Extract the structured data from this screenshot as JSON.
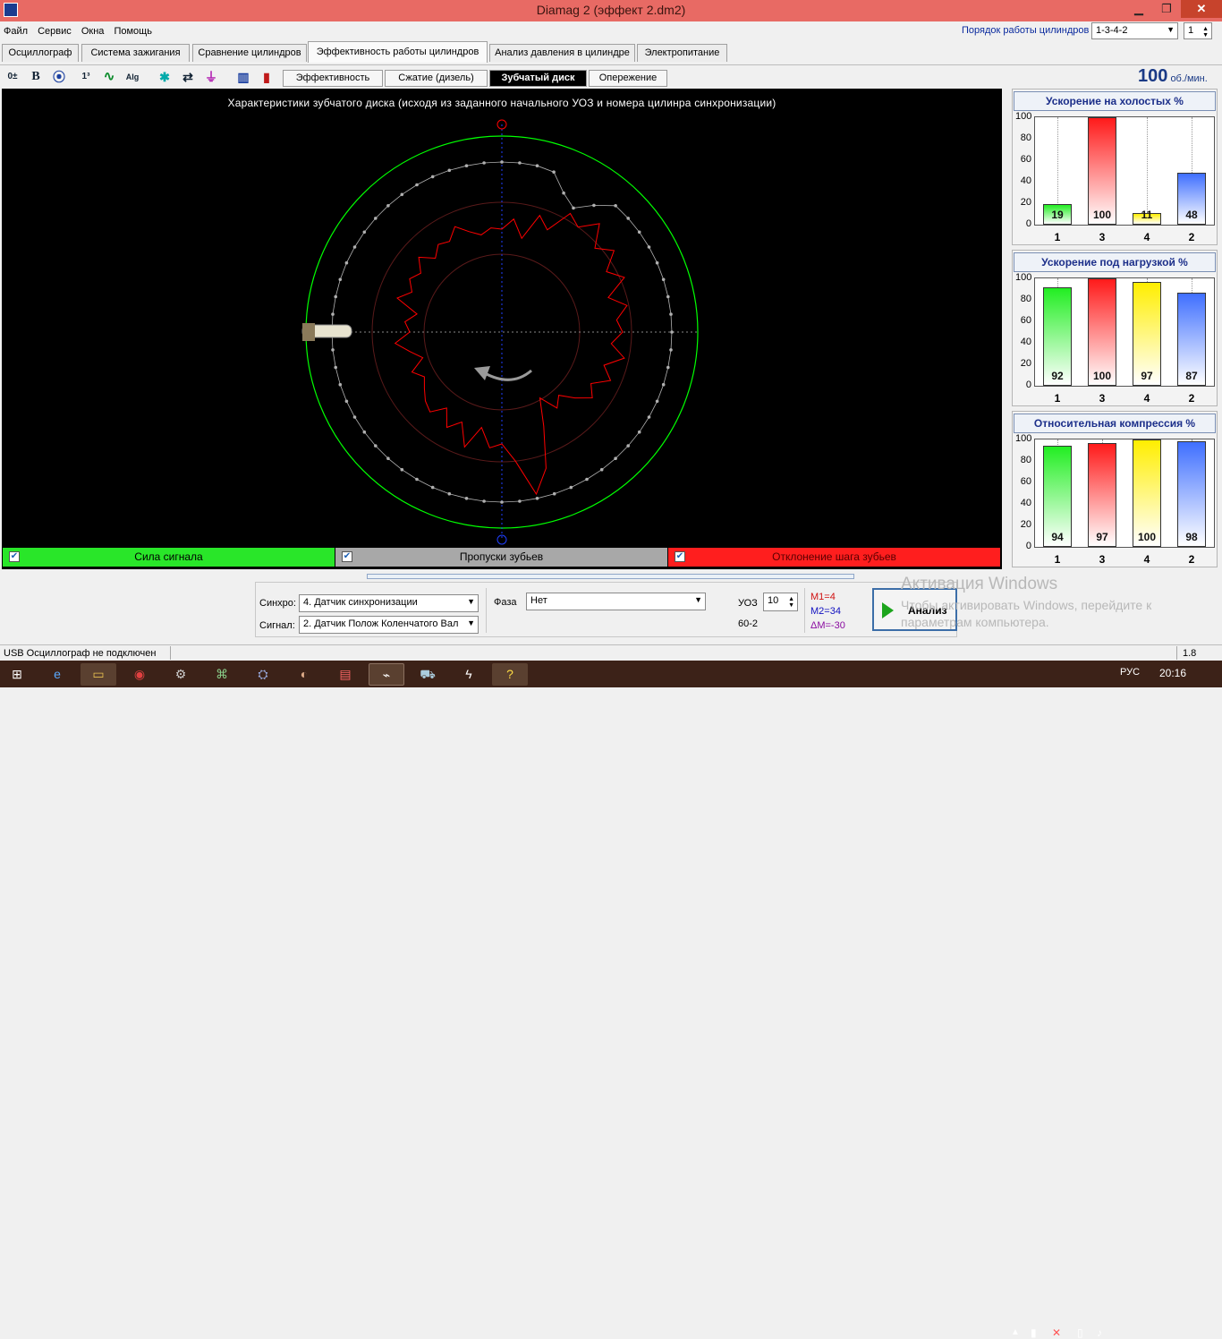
{
  "window": {
    "title": "Diamag 2 (эффект 2.dm2)",
    "minimize": "▁",
    "maximize": "❐",
    "close": "✕"
  },
  "menu": [
    "Файл",
    "Сервис",
    "Окна",
    "Помощь"
  ],
  "cylinder_order": {
    "label": "Порядок работы цилиндров",
    "value": "1-3-4-2",
    "index_value": "1"
  },
  "tabs": [
    "Осциллограф",
    "Система зажигания",
    "Сравнение цилиндров",
    "Эффективность работы цилиндров",
    "Анализ давления в цилиндре",
    "Электропитание"
  ],
  "active_tab": "Эффективность работы цилиндров",
  "toolbar_icons": [
    {
      "icon": "zero-line-icon",
      "glyph": "0±"
    },
    {
      "icon": "bold-icon",
      "glyph": "B"
    },
    {
      "icon": "rpm-gauge-icon",
      "glyph": "⦿"
    },
    {
      "icon": "cylinder-numbers-icon",
      "glyph": "1³"
    },
    {
      "icon": "curve-icon",
      "glyph": "∿"
    },
    {
      "icon": "algorithm-icon",
      "glyph": "Alg"
    },
    {
      "icon": "sensor-icon",
      "glyph": "✱"
    },
    {
      "icon": "sequence-icon",
      "glyph": "⇄"
    },
    {
      "icon": "filter-icon",
      "glyph": "⏚"
    },
    {
      "icon": "car-bars-icon",
      "glyph": "▥"
    },
    {
      "icon": "bars-number-icon",
      "glyph": "▮"
    }
  ],
  "subtabs": [
    "Эффективность",
    "Сжатие (дизель)",
    "Зубчатый диск",
    "Опережение"
  ],
  "active_subtab": "Зубчатый диск",
  "rpm": {
    "value": "100",
    "unit": "об./мин."
  },
  "disk_chart": {
    "title": "Характеристики зубчатого диска (исходя из заданного начального УОЗ и номера цилинра синхронизации)",
    "teeth_count": 60,
    "missing_teeth": 2,
    "colors": {
      "signal": "#00ff00",
      "gaps": "#b0b0b0",
      "deviation": "#ff0000",
      "axis": "#1f3fff",
      "marker": "#ff0000"
    }
  },
  "legend": [
    {
      "label": "Сила сигнала",
      "checked": true,
      "color": "#29e629",
      "text_color": "#000000"
    },
    {
      "label": "Пропуски зубьев",
      "checked": true,
      "color": "#a8a8a8",
      "text_color": "#000000"
    },
    {
      "label": "Отклонение шага зубьев",
      "checked": true,
      "color": "#ff1e1e",
      "text_color": "#5a0000"
    }
  ],
  "chart_data": [
    {
      "type": "bar",
      "title": "Ускорение на холостых %",
      "categories": [
        "1",
        "3",
        "4",
        "2"
      ],
      "values": [
        19,
        100,
        11,
        48
      ],
      "ylim": [
        0,
        100
      ],
      "yticks": [
        "100",
        "80",
        "60",
        "40",
        "20",
        "0"
      ],
      "colors": [
        "#22ee22",
        "#ff1a1a",
        "#ffee00",
        "#3f6fff"
      ]
    },
    {
      "type": "bar",
      "title": "Ускорение под нагрузкой %",
      "categories": [
        "1",
        "3",
        "4",
        "2"
      ],
      "values": [
        92,
        100,
        97,
        87
      ],
      "ylim": [
        0,
        100
      ],
      "yticks": [
        "100",
        "80",
        "60",
        "40",
        "20",
        "0"
      ],
      "colors": [
        "#22ee22",
        "#ff1a1a",
        "#ffee00",
        "#3f6fff"
      ]
    },
    {
      "type": "bar",
      "title": "Относительная компрессия %",
      "categories": [
        "1",
        "3",
        "4",
        "2"
      ],
      "values": [
        94,
        97,
        100,
        98
      ],
      "ylim": [
        0,
        100
      ],
      "yticks": [
        "100",
        "80",
        "60",
        "40",
        "20",
        "0"
      ],
      "colors": [
        "#22ee22",
        "#ff1a1a",
        "#ffee00",
        "#3f6fff"
      ]
    }
  ],
  "controls": {
    "sync_label": "Синхро:",
    "sync_value": "4.  Датчик синхронизации",
    "signal_label": "Сигнал:",
    "signal_value": "2.  Датчик Полож Коленчатого Вал",
    "phase_label": "Фаза",
    "phase_value": "Нет",
    "uoz_label": "УОЗ",
    "uoz_value": "10",
    "wheel_type": "60-2",
    "m1": "M1=4",
    "m2": "M2=34",
    "dm": "ΔM=-30",
    "analyze_label": "Анализ"
  },
  "watermark": {
    "title": "Активация Windows",
    "text": "Чтобы активировать Windows, перейдите к параметрам компьютера."
  },
  "status": {
    "left": "USB Осциллограф не подключен",
    "right": "1.8"
  },
  "taskbar": {
    "lang": "РУС",
    "time": "20:16"
  }
}
